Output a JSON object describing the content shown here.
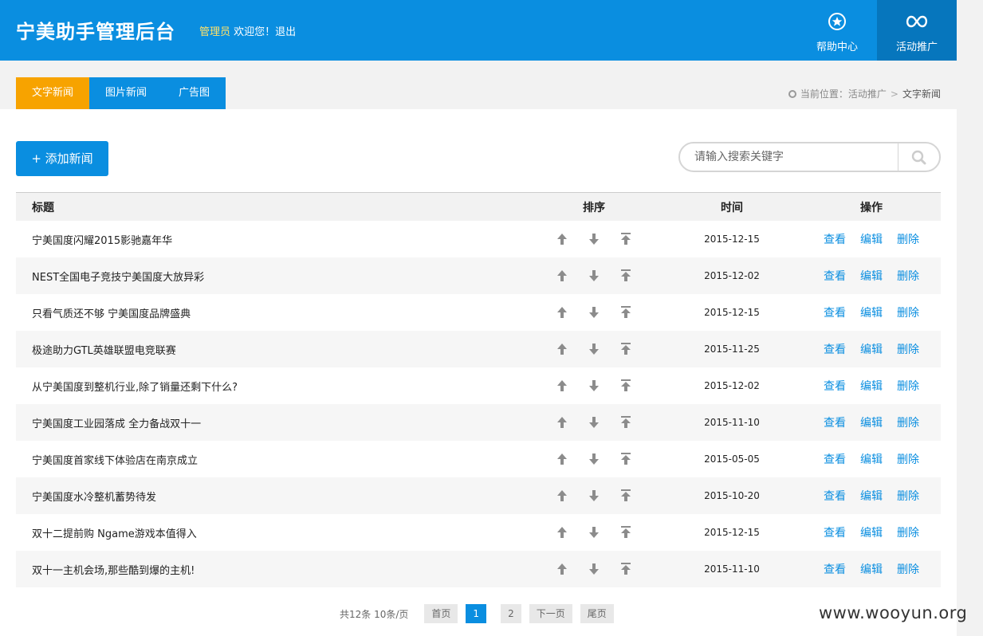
{
  "header": {
    "title": "宁美助手管理后台",
    "role": "管理员",
    "welcome": " 欢迎您！",
    "logout": "退出",
    "nav": [
      {
        "label": "帮助中心",
        "icon": "star-badge-icon"
      },
      {
        "label": "活动推广",
        "icon": "infinity-link-icon"
      }
    ]
  },
  "tabs": [
    {
      "label": "文字新闻",
      "active": true
    },
    {
      "label": "图片新闻",
      "active": false
    },
    {
      "label": "广告图",
      "active": false
    }
  ],
  "breadcrumb": {
    "prefix": "当前位置：活动推广",
    "current": "文字新闻"
  },
  "toolbar": {
    "add_label": "+ 添加新闻",
    "search_placeholder": "请输入搜索关键字"
  },
  "table": {
    "headers": {
      "title": "标题",
      "sort": "排序",
      "time": "时间",
      "ops": "操作"
    },
    "ops": {
      "view": "查看",
      "edit": "编辑",
      "delete": "删除"
    },
    "rows": [
      {
        "title": "宁美国度闪耀2015影驰嘉年华",
        "time": "2015-12-15"
      },
      {
        "title": "NEST全国电子竞技宁美国度大放异彩",
        "time": "2015-12-02"
      },
      {
        "title": "只看气质还不够 宁美国度品牌盛典",
        "time": "2015-12-15"
      },
      {
        "title": "极途助力GTL英雄联盟电竞联赛",
        "time": "2015-11-25"
      },
      {
        "title": "从宁美国度到整机行业,除了销量还剩下什么?",
        "time": "2015-12-02"
      },
      {
        "title": "宁美国度工业园落成 全力备战双十一",
        "time": "2015-11-10"
      },
      {
        "title": "宁美国度首家线下体验店在南京成立",
        "time": "2015-05-05"
      },
      {
        "title": "宁美国度水冷整机蓄势待发",
        "time": "2015-10-20"
      },
      {
        "title": "双十二提前购 Ngame游戏本值得入",
        "time": "2015-12-15"
      },
      {
        "title": "双十一主机会场,那些酷到爆的主机!",
        "time": "2015-11-10"
      }
    ]
  },
  "pager": {
    "info": "共12条 10条/页",
    "first": "首页",
    "pages": [
      "1",
      "2"
    ],
    "current_page": "1",
    "next": "下一页",
    "last": "尾页"
  },
  "watermark": "www.wooyun.org",
  "colors": {
    "brand": "#0a8ee0",
    "active_tab": "#f7a300",
    "nav_active": "#0676bd"
  }
}
